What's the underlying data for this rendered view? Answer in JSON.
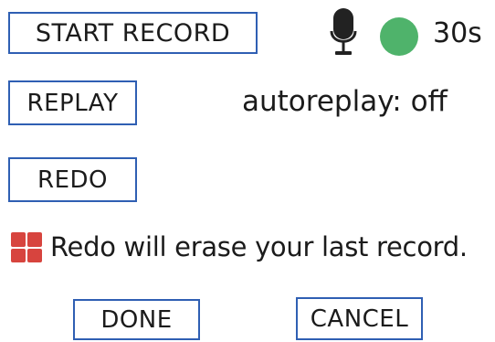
{
  "recorder": {
    "start_label": "START RECORD",
    "timer": "30s",
    "status_color": "#4fb36b"
  },
  "controls": {
    "replay_label": "REPLAY",
    "redo_label": "REDO",
    "autoreplay_text": "autoreplay: off"
  },
  "warning": {
    "text": "Redo will erase your last record.",
    "icon": "warning-icon",
    "icon_color": "#d7443e"
  },
  "footer": {
    "done_label": "DONE",
    "cancel_label": "CANCEL"
  },
  "theme": {
    "border_color": "#2f5fb3"
  },
  "icons": {
    "mic": "microphone-icon",
    "record": "recording-status-dot"
  }
}
